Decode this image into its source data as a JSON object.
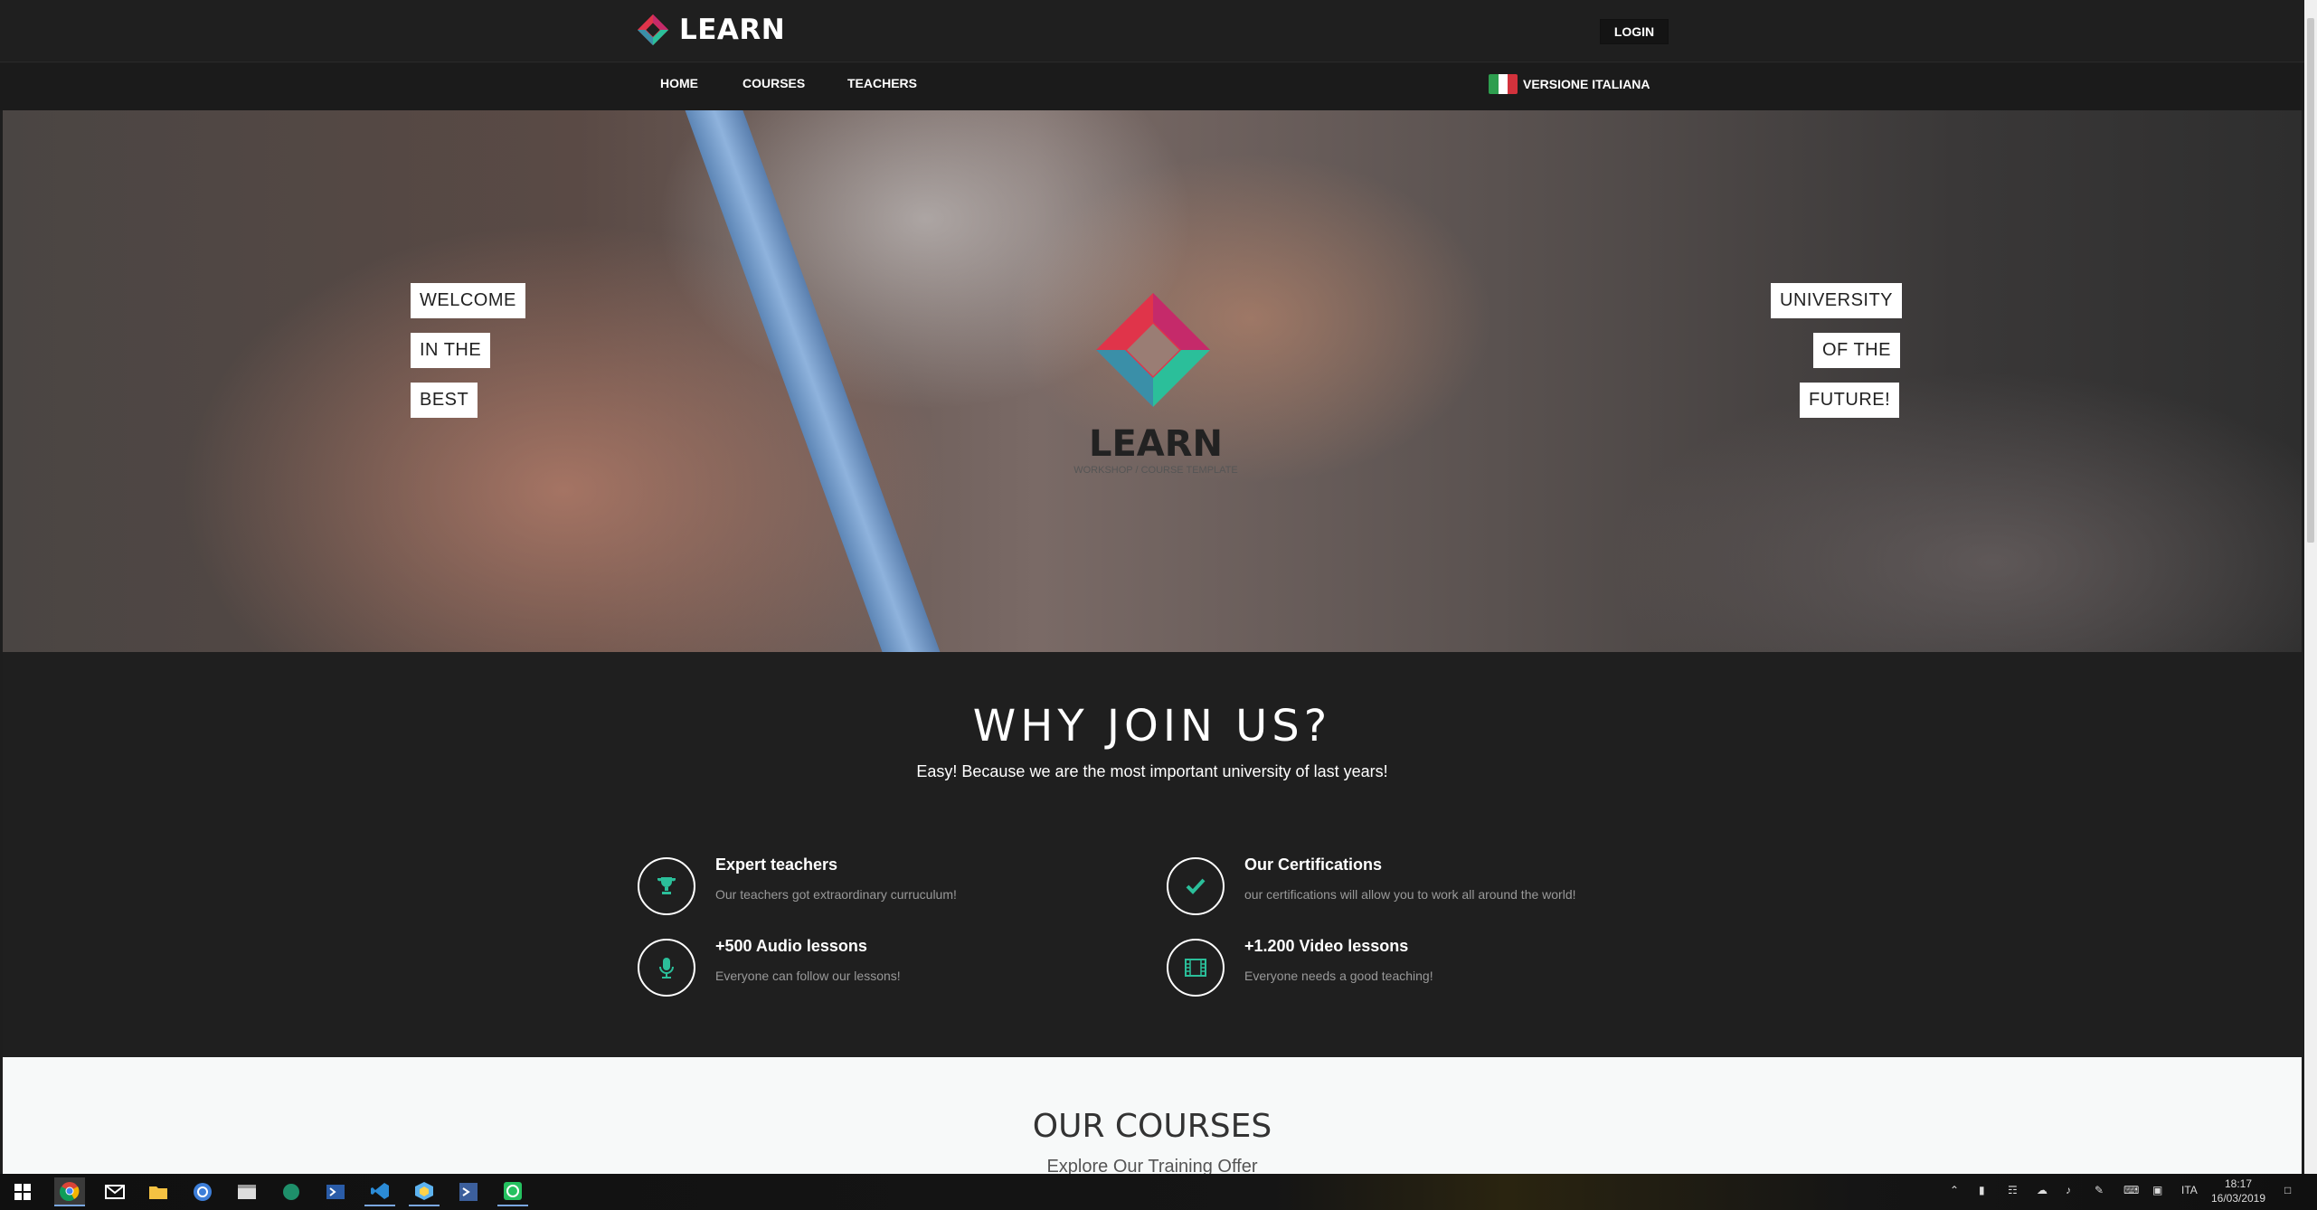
{
  "header": {
    "logo_text": "LEARN",
    "login_label": "LOGIN"
  },
  "nav": {
    "items": [
      {
        "label": "HOME"
      },
      {
        "label": "COURSES"
      },
      {
        "label": "TEACHERS"
      }
    ],
    "language_label": "VERSIONE ITALIANA"
  },
  "hero": {
    "left_words": [
      "WELCOME",
      "IN THE",
      "BEST"
    ],
    "right_words": [
      "UNIVERSITY",
      "OF THE",
      "FUTURE!"
    ],
    "logo_text": "LEARN",
    "logo_subtitle": "WORKSHOP / COURSE TEMPLATE"
  },
  "why": {
    "title": "WHY JOIN US?",
    "subtitle": "Easy! Because we are the most important university of last years!",
    "features": [
      {
        "icon": "trophy-icon",
        "title": "Expert teachers",
        "desc": "Our teachers got extraordinary curruculum!"
      },
      {
        "icon": "check-icon",
        "title": "Our Certifications",
        "desc": "our certifications will allow you to work all around the world!"
      },
      {
        "icon": "microphone-icon",
        "title": "+500 Audio lessons",
        "desc": "Everyone can follow our lessons!"
      },
      {
        "icon": "film-icon",
        "title": "+1.200 Video lessons",
        "desc": "Everyone needs a good teaching!"
      }
    ]
  },
  "courses": {
    "title": "OUR COURSES",
    "subtitle": "Explore Our Training Offer"
  },
  "taskbar": {
    "language": "ITA",
    "time": "18:17",
    "date": "16/03/2019"
  },
  "colors": {
    "accent_green": "#2bbf9a",
    "logo_red": "#e0344a",
    "dark_bg": "#1f1f1f"
  }
}
